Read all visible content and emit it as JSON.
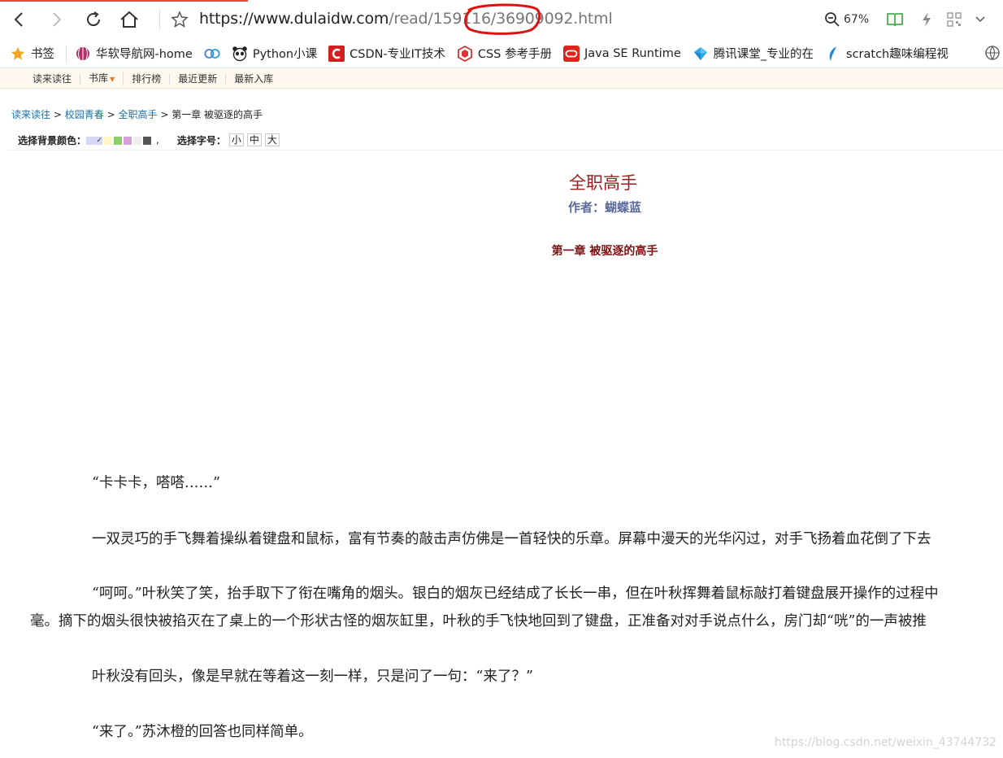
{
  "browser": {
    "url_prefix": "https://www.",
    "url_host": "dulaidw.com",
    "url_path": "/read/159116/36909092.html",
    "zoom": "67%"
  },
  "bookmarks": [
    {
      "label": "书签",
      "icon": "star-icon"
    },
    {
      "label": "华软导航网-home",
      "icon": "globe-icon"
    },
    {
      "label": "",
      "icon": "rings-icon"
    },
    {
      "label": "Python小课",
      "icon": "panda-icon"
    },
    {
      "label": "CSDN-专业IT技术",
      "icon": "csdn-icon"
    },
    {
      "label": "CSS 参考手册",
      "icon": "css-icon"
    },
    {
      "label": "Java SE Runtime",
      "icon": "oracle-icon"
    },
    {
      "label": "腾讯课堂_专业的在",
      "icon": "tencent-icon"
    },
    {
      "label": "scratch趣味编程视",
      "icon": "feather-icon"
    }
  ],
  "site_nav": [
    "读来读往",
    "书库",
    "排行榜",
    "最近更新",
    "最新入库"
  ],
  "breadcrumb": {
    "items": [
      "读来读往",
      "校园青春",
      "全职高手"
    ],
    "current": "第一章 被驱逐的高手",
    "separator": ">"
  },
  "settings": {
    "bg_label": "选择背景颜色：",
    "bg_colors": [
      "#d6d6f5",
      "#fff7c8",
      "#8ccf6a",
      "#d8a0d8",
      "#eeeeee",
      "#555555"
    ],
    "font_label": "选择字号：",
    "font_sizes": [
      "小",
      "中",
      "大"
    ]
  },
  "book": {
    "title": "全职高手",
    "author": "作者：蝴蝶蓝",
    "chapter": "第一章 被驱逐的高手"
  },
  "paragraphs": [
    "“卡卡卡，嗒嗒……”",
    "一双灵巧的手飞舞着操纵着键盘和鼠标，富有节奏的敲击声仿佛是一首轻快的乐章。屏幕中漫天的光华闪过，对手飞扬着血花倒了下去",
    "“呵呵。”叶秋笑了笑，抬手取下了衔在嘴角的烟头。银白的烟灰已经结成了长长一串，但在叶秋挥舞着鼠标敲打着键盘展开操作的过程中",
    "毫。摘下的烟头很快被掐灭在了桌上的一个形状古怪的烟灰缸里，叶秋的手飞快地回到了键盘，正准备对对手说点什么，房门却“咣”的一声被推",
    "叶秋没有回头，像是早就在等着这一刻一样，只是问了一句：“来了？”",
    "“来了。”苏沐橙的回答也同样简单。"
  ],
  "watermark": "https://blog.csdn.net/weixin_43744732"
}
